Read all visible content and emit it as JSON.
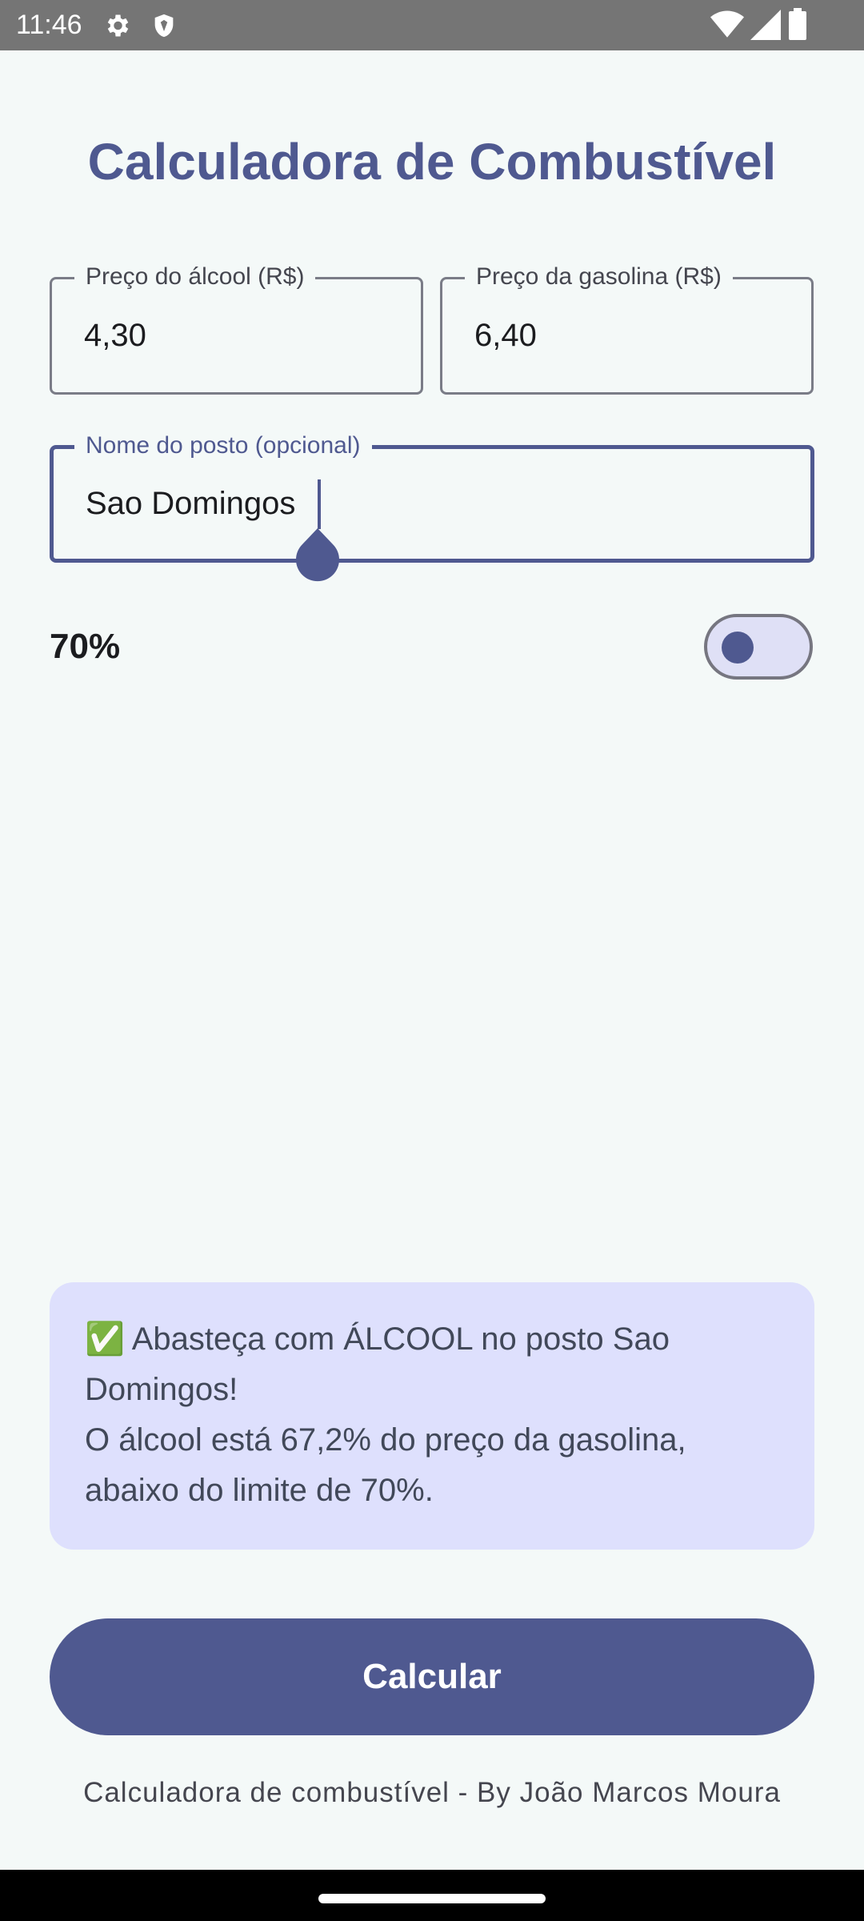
{
  "status_bar": {
    "time": "11:46",
    "icons": [
      "gear-icon",
      "shield-icon",
      "wifi-icon",
      "signal-icon",
      "battery-icon"
    ]
  },
  "app": {
    "title": "Calculadora de Combustível",
    "accent_color": "#4f5990"
  },
  "fields": {
    "alcohol": {
      "label": "Preço do álcool (R$)",
      "value": "4,30"
    },
    "gasoline": {
      "label": "Preço da gasolina (R$)",
      "value": "6,40"
    },
    "station": {
      "label": "Nome do posto (opcional)",
      "value": "Sao Domingos"
    }
  },
  "threshold": {
    "label": "70%",
    "switch_on": false
  },
  "result": {
    "lines": [
      "✅ Abasteça com ÁLCOOL no posto Sao",
      "Domingos!",
      "O álcool está 67,2% do preço da gasolina,",
      "abaixo do limite de 70%."
    ]
  },
  "actions": {
    "calculate_label": "Calcular"
  },
  "footer": {
    "text": "Calculadora de combustível - By João Marcos Moura"
  }
}
